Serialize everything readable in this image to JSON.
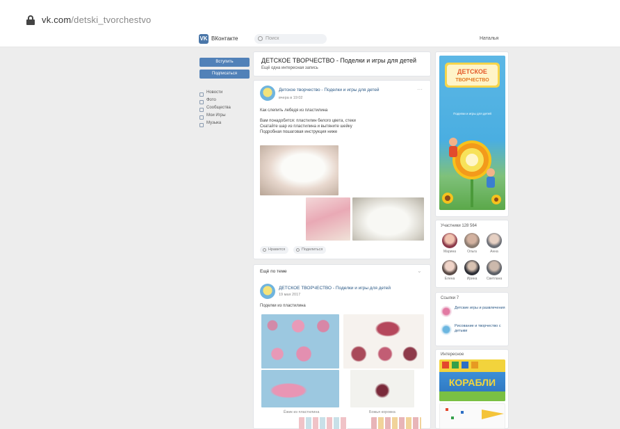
{
  "browser": {
    "url_domain": "vk.com",
    "url_path": "/detski_tvorchestvo"
  },
  "vk": {
    "logo_label": "VK",
    "site_name": "ВКонтакте",
    "search_placeholder": "Поиск",
    "user_label": "Наталья"
  },
  "left": {
    "join_button": "Вступить",
    "subscribe_button": "Подписаться",
    "nav": [
      "Новости",
      "Фото",
      "Сообщества",
      "Мои Игры",
      "Музыка"
    ]
  },
  "group": {
    "title": "ДЕТСКОЕ ТВОРЧЕСТВО - Поделки и игры для детей",
    "status": "Ещё одна интересная запись"
  },
  "post1": {
    "author": "Детское творчество - Поделки и игры для детей",
    "date": "вчера в 19:02",
    "text": [
      "Как слепить лебедя из пластилина",
      "Вам понадобится: пластилин белого цвета, стеки",
      "Скатайте шар из пластилина и вытяните шейку",
      "Подробная пошаговая инструкция ниже"
    ],
    "like": "Нравится",
    "share": "Поделиться"
  },
  "post2": {
    "header": "Ещё по теме",
    "author": "ДЕТСКОЕ ТВОРЧЕСТВО - Поделки и игры для детей",
    "date": "19 мая 2017",
    "text": "Поделки из пластилина",
    "caption1": "Ёжик из пластилина",
    "caption2": "Божья коровка"
  },
  "right": {
    "banner": {
      "line1": "ДЕТСКОЕ",
      "line2": "ТВОРЧЕСТВО",
      "subtitle": "Поделки и игры для детей"
    },
    "members_title": "Участники 128 564",
    "members": [
      "Марина",
      "Ольга",
      "Анна",
      "Елена",
      "Ирина",
      "Светлана"
    ],
    "links_title": "Ссылки 7",
    "links": [
      {
        "title": "Детские игры и развлечения"
      },
      {
        "title": "Рисование и творчество с детьми"
      }
    ],
    "ad_title": "Интересное",
    "ad_text": "КОРАБЛИ"
  },
  "colors": {
    "vk_blue": "#4a76a8",
    "button": "#5181b8",
    "link": "#2a5885",
    "page_bg": "#ededed"
  }
}
